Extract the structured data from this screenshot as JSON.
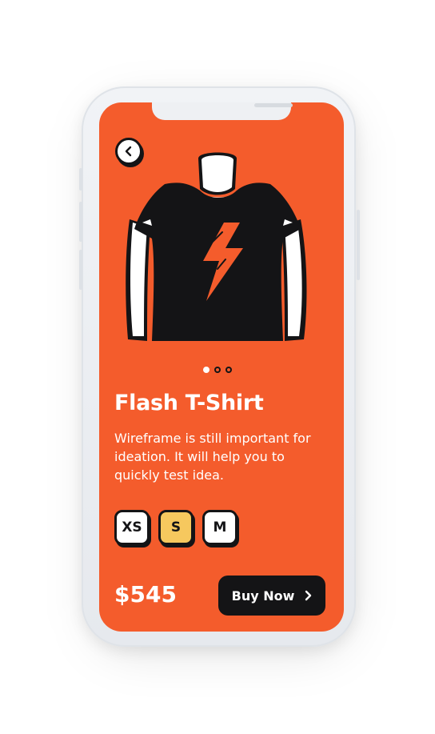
{
  "product": {
    "title": "Flash T-Shirt",
    "description": "Wireframe is still important for ideation. It will help you to quickly test idea.",
    "price": "$545"
  },
  "carousel": {
    "total": 3,
    "active_index": 0
  },
  "sizes": {
    "options": [
      "XS",
      "S",
      "M"
    ],
    "selected": "S"
  },
  "actions": {
    "buy_label": "Buy Now",
    "buy_icon": "chevron-right-icon",
    "back_icon": "chevron-left-icon"
  },
  "colors": {
    "background": "#f45c2c",
    "accent": "#f6c85e",
    "dark": "#141416",
    "text": "#ffffff"
  }
}
